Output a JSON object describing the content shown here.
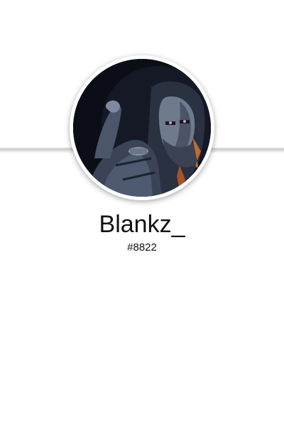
{
  "profile": {
    "username": "Blankz_",
    "discriminator": "#8822",
    "avatar_icon": "avatar-dark-hooded-figure"
  },
  "colors": {
    "background": "#ffffff",
    "text": "#111111",
    "avatar_ring": "#ffffff",
    "avatar_bg": "#0c0f17"
  }
}
